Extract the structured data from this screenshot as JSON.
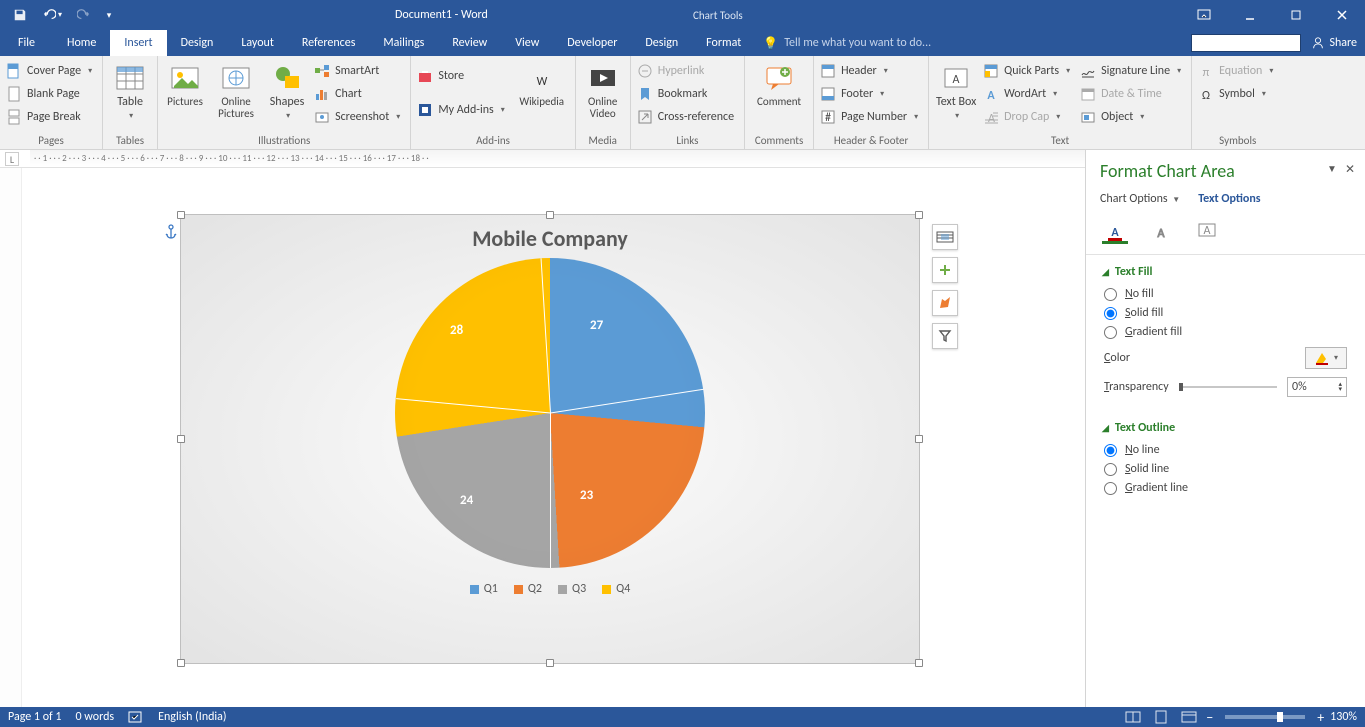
{
  "titlebar": {
    "document": "Document1 - Word",
    "contextTool": "Chart Tools"
  },
  "tabs": {
    "file": "File",
    "home": "Home",
    "insert": "Insert",
    "design": "Design",
    "layout": "Layout",
    "references": "References",
    "mailings": "Mailings",
    "review": "Review",
    "view": "View",
    "developer": "Developer",
    "ctxDesign": "Design",
    "ctxFormat": "Format",
    "tellMe": "Tell me what you want to do...",
    "share": "Share"
  },
  "ribbon": {
    "pages": {
      "label": "Pages",
      "cover": "Cover Page",
      "blank": "Blank Page",
      "break": "Page Break"
    },
    "tables": {
      "label": "Tables",
      "table": "Table"
    },
    "illustrations": {
      "label": "Illustrations",
      "pictures": "Pictures",
      "online": "Online Pictures",
      "shapes": "Shapes",
      "smartart": "SmartArt",
      "chart": "Chart",
      "screenshot": "Screenshot"
    },
    "addins": {
      "label": "Add-ins",
      "store": "Store",
      "myaddins": "My Add-ins",
      "wikipedia": "Wikipedia"
    },
    "media": {
      "label": "Media",
      "video": "Online Video"
    },
    "links": {
      "label": "Links",
      "hyperlink": "Hyperlink",
      "bookmark": "Bookmark",
      "crossref": "Cross-reference"
    },
    "comments": {
      "label": "Comments",
      "comment": "Comment"
    },
    "headerfooter": {
      "label": "Header & Footer",
      "header": "Header",
      "footer": "Footer",
      "pagenum": "Page Number"
    },
    "text": {
      "label": "Text",
      "textbox": "Text Box",
      "quickparts": "Quick Parts",
      "wordart": "WordArt",
      "dropcap": "Drop Cap",
      "sigline": "Signature Line",
      "datetime": "Date & Time",
      "object": "Object"
    },
    "symbols": {
      "label": "Symbols",
      "equation": "Equation",
      "symbol": "Symbol"
    }
  },
  "chart_data": {
    "type": "pie",
    "title": "Mobile Company",
    "categories": [
      "Q1",
      "Q2",
      "Q3",
      "Q4"
    ],
    "values": [
      27,
      23,
      24,
      28
    ],
    "colors": [
      "#5b9bd5",
      "#ed7d31",
      "#a5a5a5",
      "#ffc000"
    ],
    "legend_position": "bottom",
    "data_labels": true
  },
  "formatPane": {
    "title": "Format Chart Area",
    "chartOptions": "Chart Options",
    "textOptions": "Text Options",
    "sections": {
      "textFill": {
        "head": "Text Fill",
        "noFill": "No fill",
        "solidFill": "Solid fill",
        "gradientFill": "Gradient fill",
        "color": "Color",
        "transparency": "Transparency",
        "transValue": "0%"
      },
      "textOutline": {
        "head": "Text Outline",
        "noLine": "No line",
        "solidLine": "Solid line",
        "gradientLine": "Gradient line"
      }
    }
  },
  "status": {
    "page": "Page 1 of 1",
    "words": "0 words",
    "lang": "English (India)",
    "zoom": "130%"
  }
}
